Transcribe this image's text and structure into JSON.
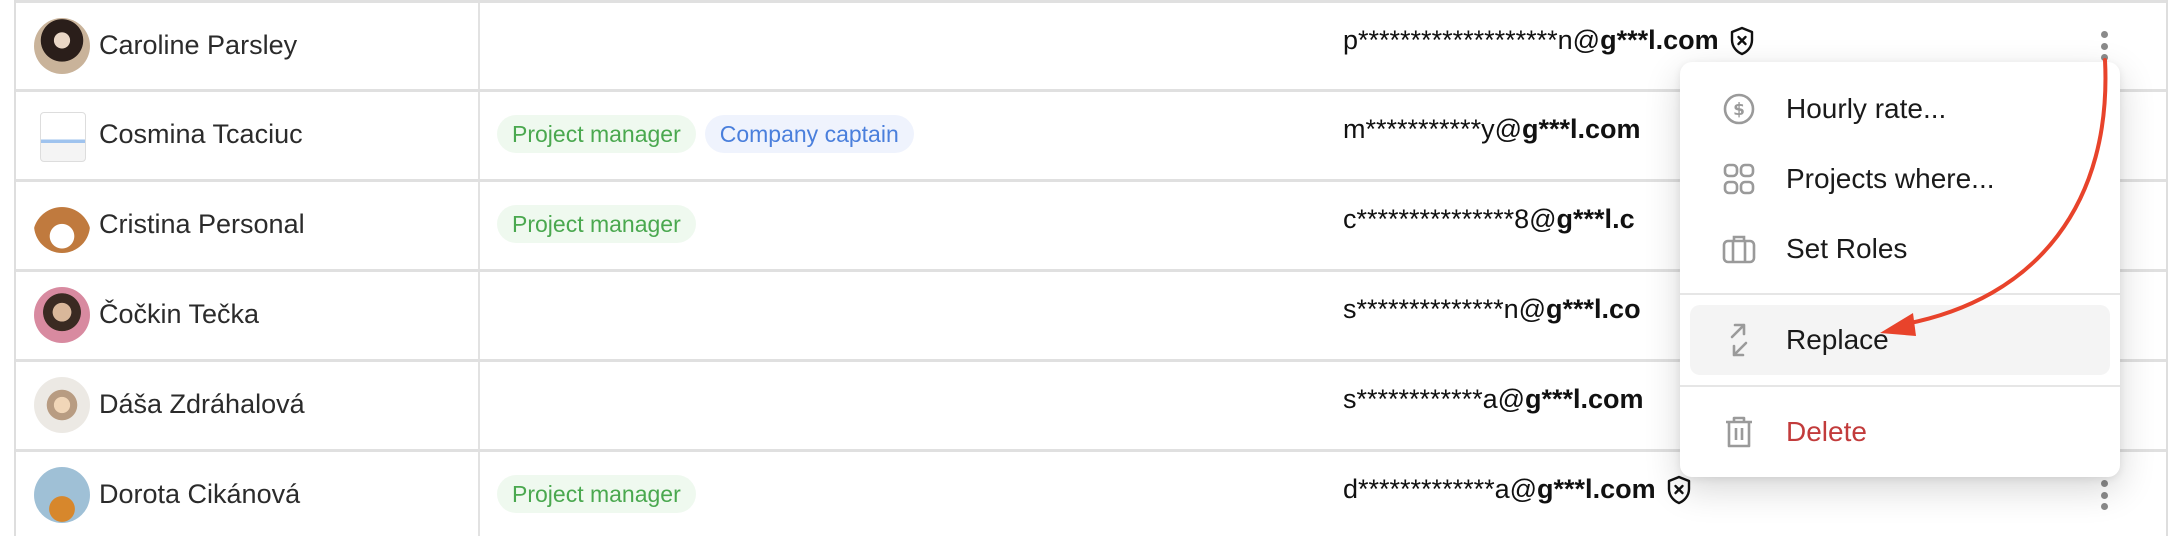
{
  "table": {
    "rows": [
      {
        "name": "Caroline Parsley",
        "avatar": "photo-avatar",
        "tags": [],
        "email_masked": "p*******************n@",
        "email_domain": "g***l.com",
        "shield_icon": "shield-x-icon",
        "shield_visible": true
      },
      {
        "name": "Cosmina Tcaciuc",
        "avatar": "sketch-avatar",
        "tags": [
          {
            "label": "Project manager",
            "color": "green"
          },
          {
            "label": "Company captain",
            "color": "blue"
          }
        ],
        "email_masked": "m***********y@",
        "email_domain": "g***l.com",
        "shield_visible": false
      },
      {
        "name": "Cristina Personal",
        "avatar": "dog-avatar",
        "tags": [
          {
            "label": "Project manager",
            "color": "green"
          }
        ],
        "email_masked": "c***************8@",
        "email_domain": "g***l.c",
        "shield_visible": false
      },
      {
        "name": "Čočkin Tečka",
        "avatar": "photo-avatar",
        "tags": [],
        "email_masked": "s**************n@",
        "email_domain": "g***l.co",
        "shield_visible": false
      },
      {
        "name": "Dáša Zdráhalová",
        "avatar": "photo-avatar",
        "tags": [],
        "email_masked": "s************a@",
        "email_domain": "g***l.com",
        "shield_visible": false
      },
      {
        "name": "Dorota Cikánová",
        "avatar": "photo-avatar",
        "tags": [
          {
            "label": "Project manager",
            "color": "green"
          }
        ],
        "email_masked": "d*************a@",
        "email_domain": "g***l.com",
        "shield_icon": "shield-x-icon",
        "shield_visible": true
      }
    ]
  },
  "context_menu": {
    "items": [
      {
        "label": "Hourly rate...",
        "icon": "dollar-circle-icon"
      },
      {
        "label": "Projects where...",
        "icon": "grid-icon"
      },
      {
        "label": "Set Roles",
        "icon": "briefcase-icon"
      },
      {
        "label": "Replace",
        "icon": "swap-arrows-icon",
        "highlighted": true
      },
      {
        "label": "Delete",
        "icon": "trash-icon",
        "danger": true
      }
    ]
  },
  "colors": {
    "tag_green_text": "#4aa84f",
    "tag_green_bg": "#eff9ef",
    "tag_blue_text": "#4a7fdc",
    "tag_blue_bg": "#eff3fd",
    "danger": "#c23b3b",
    "annotation_arrow": "#e8432b"
  }
}
